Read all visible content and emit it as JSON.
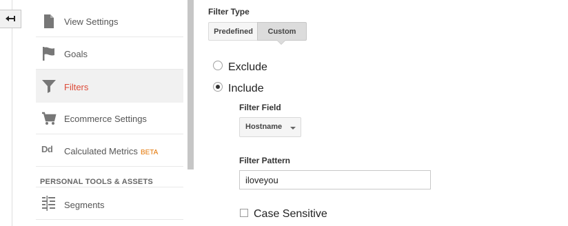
{
  "sidebar": {
    "items": [
      {
        "label": "View Settings",
        "icon": "document-icon"
      },
      {
        "label": "Goals",
        "icon": "flag-icon"
      },
      {
        "label": "Filters",
        "icon": "filter-icon",
        "active": true
      },
      {
        "label": "Ecommerce Settings",
        "icon": "cart-icon"
      },
      {
        "label": "Calculated Metrics",
        "badge": "BETA",
        "icon": "dd-icon",
        "icon_text": "Dd"
      }
    ],
    "section_heading": "PERSONAL TOOLS & ASSETS",
    "section_items": [
      {
        "label": "Segments",
        "icon": "segments-icon"
      }
    ]
  },
  "filter": {
    "type_label": "Filter Type",
    "type_options": [
      "Predefined",
      "Custom"
    ],
    "type_selected": "Custom",
    "exclude_label": "Exclude",
    "include_label": "Include",
    "mode_selected": "Include",
    "field_label": "Filter Field",
    "field_value": "Hostname",
    "pattern_label": "Filter Pattern",
    "pattern_value": "iloveyou",
    "case_label": "Case Sensitive",
    "case_checked": false
  },
  "colors": {
    "active_text": "#dd4b39",
    "beta": "#e37400",
    "active_bg": "#f1f1f1"
  }
}
